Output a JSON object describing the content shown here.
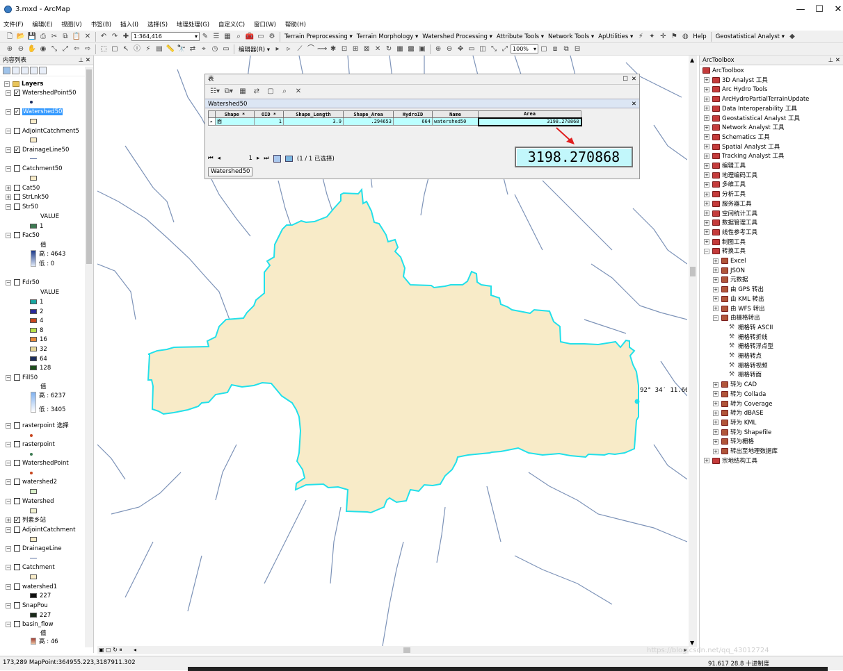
{
  "window": {
    "title": "3.mxd - ArcMap",
    "minimize": "—",
    "maximize": "☐",
    "close": "✕"
  },
  "menu": [
    "文件(F)",
    "编辑(E)",
    "视图(V)",
    "书签(B)",
    "插入(I)",
    "选择(S)",
    "地理处理(G)",
    "自定义(C)",
    "窗口(W)",
    "帮助(H)"
  ],
  "toolbar1": {
    "scale": "1:364,416",
    "items": [
      "Terrain Preprocessing ▾",
      "Terrain Morphology ▾",
      "Watershed Processing ▾",
      "Attribute Tools ▾",
      "Network Tools ▾",
      "ApUtilities ▾",
      "Help",
      "Geostatistical Analyst ▾"
    ]
  },
  "toolbar2": {
    "editor": "编辑器(R) ▾",
    "zoom": "100%"
  },
  "toc": {
    "title": "内容列表",
    "root": "Layers",
    "layers": [
      {
        "name": "WatershedPoint50",
        "checked": true
      },
      {
        "name": "Watershed50",
        "checked": true
      },
      {
        "name": "AdjointCatchment5",
        "checked": false
      },
      {
        "name": "DrainageLine50",
        "checked": true
      },
      {
        "name": "Catchment50",
        "checked": false
      },
      {
        "name": "Cat50",
        "checked": false
      },
      {
        "name": "StrLnk50",
        "checked": false
      },
      {
        "name": "Str50",
        "checked": false
      },
      {
        "name": "Fac50",
        "checked": false
      },
      {
        "name": "Fdr50",
        "checked": false
      },
      {
        "name": "Fill50",
        "checked": false
      },
      {
        "name": "rasterpoint 选择",
        "checked": false
      },
      {
        "name": "rasterpoint",
        "checked": false
      },
      {
        "name": "WatershedPoint",
        "checked": false
      },
      {
        "name": "watershed2",
        "checked": false
      },
      {
        "name": "Watershed",
        "checked": false
      },
      {
        "name": "列素乡站",
        "checked": true
      },
      {
        "name": "AdjointCatchment",
        "checked": false
      },
      {
        "name": "DrainageLine",
        "checked": false
      },
      {
        "name": "Catchment",
        "checked": false
      },
      {
        "name": "watershed1",
        "checked": false
      },
      {
        "name": "SnapPou",
        "checked": false
      },
      {
        "name": "basin_flow",
        "checked": false
      }
    ],
    "legend": {
      "value": "VALUE",
      "val_zh": "值",
      "str_one": "1",
      "fac_high": "高 : 4643",
      "fac_low": "低 : 0",
      "fdr_values": [
        "1",
        "2",
        "4",
        "8",
        "16",
        "32",
        "64",
        "128"
      ],
      "fdr_colors": [
        "#1aa6a0",
        "#2b2b9a",
        "#c8461e",
        "#b7e04a",
        "#e68a3c",
        "#e6d79a",
        "#1d2d5c",
        "#1d4f1d"
      ],
      "fill_high": "高 : 6237",
      "fill_low": "低 : 3405",
      "w1": "227",
      "snap": "227",
      "basin_high": "高 : 46"
    }
  },
  "table": {
    "window_title": "表",
    "layer_tab": "Watershed50",
    "columns": [
      "Shape *",
      "OID *",
      "Shape_Length",
      "Shape_Area",
      "HydroID",
      "Name",
      "Area"
    ],
    "row": [
      "面",
      "1",
      "3.9",
      ".294653",
      "664",
      "watershed50",
      "3198.270868"
    ],
    "big_value": "3198.270868",
    "nav_page": "1",
    "selection": "(1 / 1 已选择)"
  },
  "map": {
    "coord_label": "92° 34′ 11.66′",
    "polygon_fill": "#f8ebc8",
    "polygon_stroke": "#22e0ea",
    "river_color": "#7d93b8"
  },
  "toolbox": {
    "title": "ArcToolbox",
    "root": "ArcToolbox",
    "items": [
      "3D Analyst 工具",
      "Arc Hydro Tools",
      "ArcHydroPartialTerrainUpdate",
      "Data Interoperability 工具",
      "Geostatistical Analyst 工具",
      "Network Analyst 工具",
      "Schematics 工具",
      "Spatial Analyst 工具",
      "Tracking Analyst 工具",
      "编辑工具",
      "地理编码工具",
      "多维工具",
      "分析工具",
      "服务器工具",
      "空间统计工具",
      "数据管理工具",
      "线性参考工具",
      "制图工具",
      "转换工具"
    ],
    "conversion_children": [
      "Excel",
      "JSON",
      "元数据",
      "由 GPS 转出",
      "由 KML 转出",
      "由 WFS 转出",
      "由栅格转出"
    ],
    "raster_children": [
      "栅格转 ASCII",
      "栅格转折线",
      "栅格转浮点型",
      "栅格转点",
      "栅格转视频",
      "栅格转面"
    ],
    "conversion_more": [
      "转为 CAD",
      "转为 Collada",
      "转为 Coverage",
      "转为 dBASE",
      "转为 KML",
      "转为 Shapefile",
      "转为栅格",
      "转出至地理数据库"
    ],
    "last": "宗地结构工具"
  },
  "status": {
    "left": "173,289 MapPoint:364955.223,3187911.302",
    "right": "91.617  28.8 十进制度",
    "watermark": "https://blog.csdn.net/qq_43012724"
  }
}
